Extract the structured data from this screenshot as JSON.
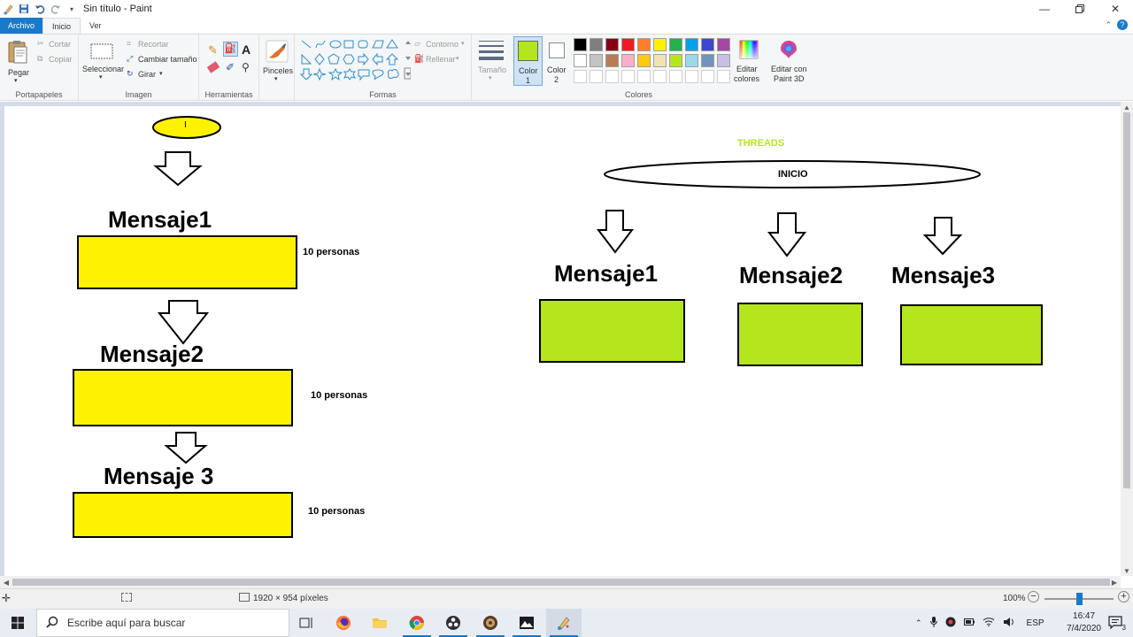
{
  "window": {
    "title": "Sin título - Paint"
  },
  "tabs": {
    "file": "Archivo",
    "home": "Inicio",
    "view": "Ver"
  },
  "ribbon": {
    "clipboard": {
      "paste": "Pegar",
      "cut": "Cortar",
      "copy": "Copiar",
      "label": "Portapapeles"
    },
    "image": {
      "select": "Seleccionar",
      "crop": "Recortar",
      "resize": "Cambiar tamaño",
      "rotate": "Girar",
      "label": "Imagen"
    },
    "tools": {
      "label": "Herramientas"
    },
    "brushes": {
      "label": "Pinceles"
    },
    "shapes": {
      "outline": "Contorno",
      "fill": "Rellenar",
      "label": "Formas"
    },
    "size": {
      "label": "Tamaño"
    },
    "color1": {
      "label": "Color",
      "num": "1",
      "value": "#b5e61d"
    },
    "color2": {
      "label": "Color",
      "num": "2",
      "value": "#ffffff"
    },
    "colors": {
      "label": "Colores",
      "edit": "Editar",
      "edit2": "colores",
      "paint3d": "Editar con",
      "paint3d2": "Paint 3D",
      "row1": [
        "#000000",
        "#7f7f7f",
        "#880015",
        "#ed1c24",
        "#ff7f27",
        "#fff200",
        "#22b14c",
        "#00a2e8",
        "#3f48cc",
        "#a349a4"
      ],
      "row2": [
        "#ffffff",
        "#c3c3c3",
        "#b97a57",
        "#ffaec9",
        "#ffc90e",
        "#efe4b0",
        "#b5e61d",
        "#99d9ea",
        "#7092be",
        "#c8bfe7"
      ]
    }
  },
  "canvas": {
    "left": {
      "oval_text": "I",
      "m1": "Mensaje1",
      "m2": "Mensaje2",
      "m3": "Mensaje 3",
      "p1": "10 personas",
      "p2": "10 personas",
      "p3": "10 personas",
      "fill": "#fff200"
    },
    "right": {
      "threads": "THREADS",
      "inicio": "INICIO",
      "m1": "Mensaje1",
      "m2": "Mensaje2",
      "m3": "Mensaje3",
      "fill": "#b5e61d",
      "threads_color": "#b5e61d"
    }
  },
  "status": {
    "dimensions": "1920 × 954 píxeles",
    "zoom": "100%"
  },
  "taskbar": {
    "search_placeholder": "Escribe aquí para buscar",
    "lang": "ESP",
    "time": "16:47",
    "date": "7/4/2020",
    "notif_count": "3"
  }
}
